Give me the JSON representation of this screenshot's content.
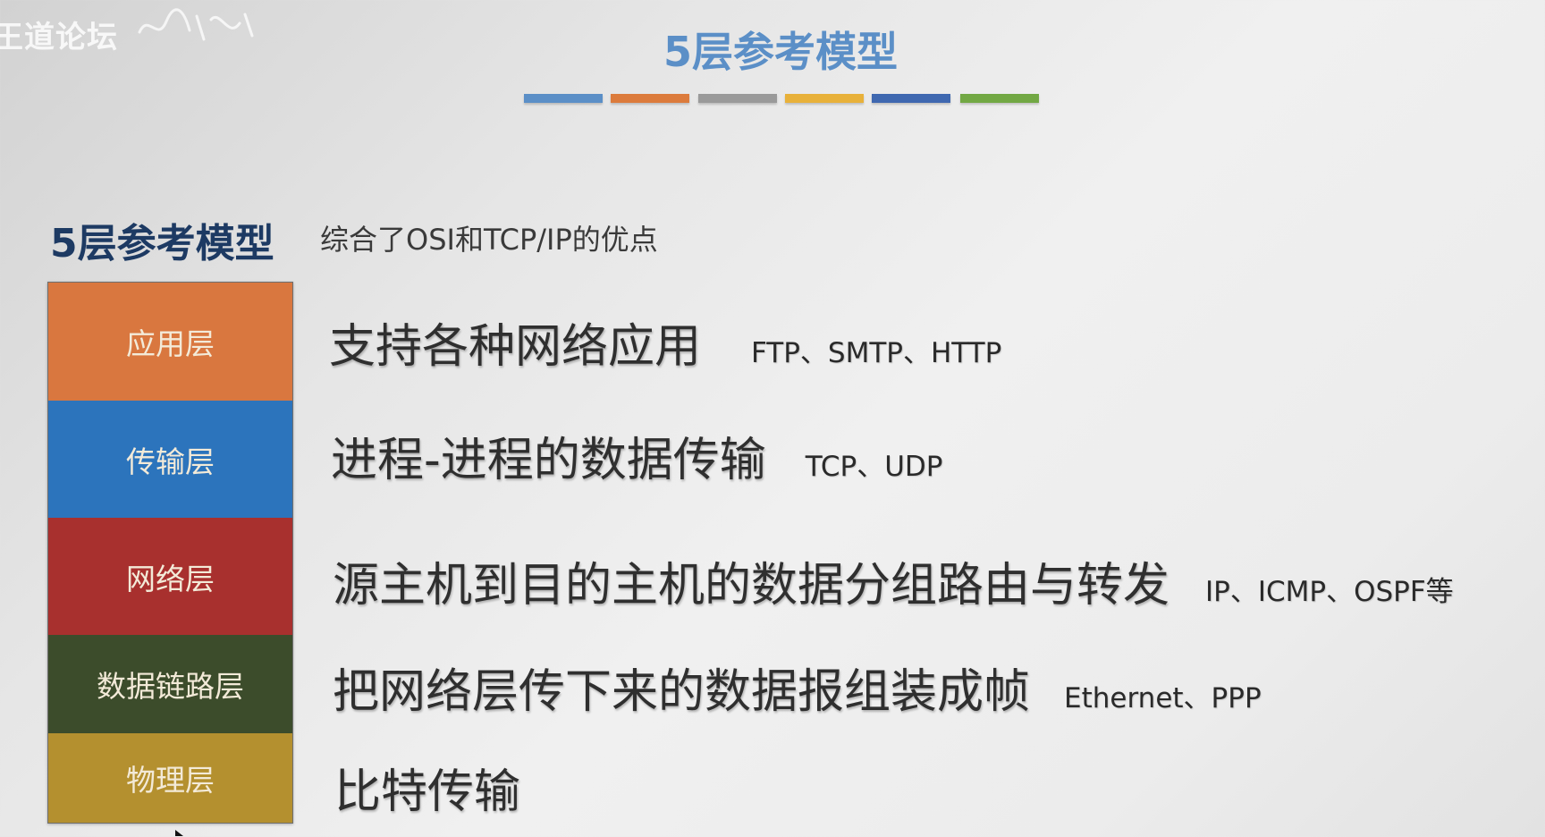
{
  "watermark": {
    "text": "王道论坛"
  },
  "slide": {
    "title": "5层参考模型",
    "color_bars": [
      {
        "color": "#5b8fc7"
      },
      {
        "color": "#dc7b3c"
      },
      {
        "color": "#9a9a9a"
      },
      {
        "color": "#e8b13a"
      },
      {
        "color": "#3f68b0"
      },
      {
        "color": "#72a844"
      }
    ]
  },
  "model": {
    "heading": "5层参考模型",
    "subtitle": "综合了OSI和TCP/IP的优点",
    "layers": [
      {
        "name": "应用层",
        "color": "#d9773f",
        "description": "支持各种网络应用",
        "protocols": "FTP、SMTP、HTTP"
      },
      {
        "name": "传输层",
        "color": "#2c74bc",
        "description": "进程-进程的数据传输",
        "protocols": "TCP、UDP"
      },
      {
        "name": "网络层",
        "color": "#a8302e",
        "description": "源主机到目的主机的数据分组路由与转发",
        "protocols": "IP、ICMP、OSPF等"
      },
      {
        "name": "数据链路层",
        "color": "#3c4c2b",
        "description": "把网络层传下来的数据报组装成帧",
        "protocols": "Ethernet、PPP"
      },
      {
        "name": "物理层",
        "color": "#b4902f",
        "description": "比特传输",
        "protocols": ""
      }
    ]
  }
}
